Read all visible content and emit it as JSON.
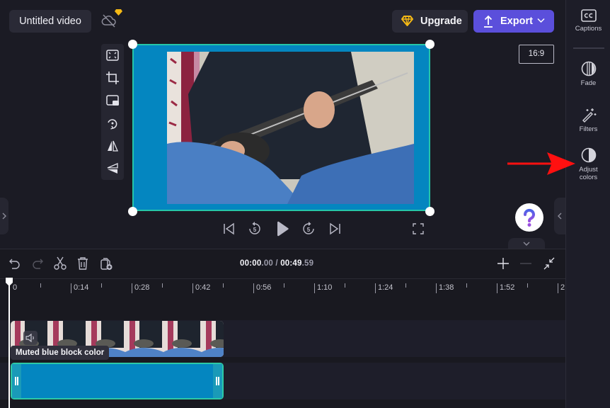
{
  "header": {
    "project_title": "Untitled video",
    "cloud_status_icon": "cloud-off-icon",
    "premium_badge_icon": "diamond-icon",
    "upgrade_label": "Upgrade",
    "export_label": "Export",
    "aspect_ratio": "16:9"
  },
  "colors": {
    "accent": "#5b4fdb",
    "premium": "#f5b915",
    "clip_background": "#0486c0",
    "selection": "#25c6a8",
    "annotation_arrow": "#ff1010"
  },
  "sidebar": {
    "items": [
      {
        "label": "Captions",
        "icon": "cc-icon"
      },
      {
        "label": "Fade",
        "icon": "fade-icon"
      },
      {
        "label": "Filters",
        "icon": "magic-wand-icon"
      },
      {
        "label": "Adjust colors",
        "label_line1": "Adjust",
        "label_line2": "colors",
        "icon": "contrast-icon"
      }
    ]
  },
  "canvas_tools": [
    {
      "name": "fit",
      "icon": "fit-screen-icon"
    },
    {
      "name": "crop",
      "icon": "crop-icon"
    },
    {
      "name": "picture-in-picture",
      "icon": "pip-icon"
    },
    {
      "name": "rotate",
      "icon": "rotate-icon"
    },
    {
      "name": "flip-horizontal",
      "icon": "flip-horizontal-icon"
    },
    {
      "name": "flip-vertical",
      "icon": "flip-vertical-icon"
    }
  ],
  "playback": {
    "skip_back_seconds": "5",
    "skip_forward_seconds": "5"
  },
  "timeline": {
    "current_time_main": "00:00",
    "current_time_frac": ".00",
    "separator": " / ",
    "total_time_main": "00:49",
    "total_time_frac": ".59",
    "ruler_labels": [
      "0",
      "0:14",
      "0:28",
      "0:42",
      "0:56",
      "1:10",
      "1:24",
      "1:38",
      "1:52",
      "2"
    ],
    "clip_tooltip": "Muted blue block color"
  },
  "help_label": "?"
}
